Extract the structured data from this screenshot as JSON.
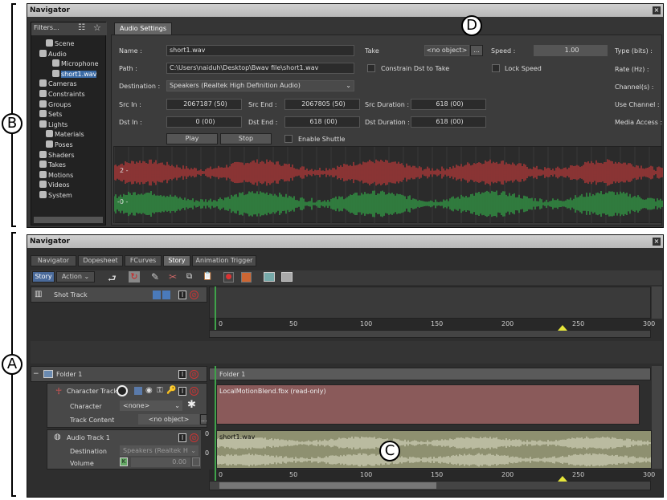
{
  "callouts": {
    "a": "A",
    "b": "B",
    "c": "C",
    "d": "D"
  },
  "top": {
    "title": "Navigator",
    "close": "×",
    "filters": "Filters...",
    "tree": [
      {
        "label": "Scene",
        "color": "#ddd"
      },
      {
        "label": "Audio",
        "color": "#ddd"
      },
      {
        "label": "Microphone",
        "color": "#ddd"
      },
      {
        "label": "short1.wav",
        "color": "#fff"
      },
      {
        "label": "Cameras",
        "color": "#ddd"
      },
      {
        "label": "Constraints",
        "color": "#ddd"
      },
      {
        "label": "Groups",
        "color": "#ddd"
      },
      {
        "label": "Sets",
        "color": "#ddd"
      },
      {
        "label": "Lights",
        "color": "#ddd"
      },
      {
        "label": "Materials",
        "color": "#ddd"
      },
      {
        "label": "Poses",
        "color": "#ddd"
      },
      {
        "label": "Shaders",
        "color": "#ddd"
      },
      {
        "label": "Takes",
        "color": "#ddd"
      },
      {
        "label": "Motions",
        "color": "#ddd"
      },
      {
        "label": "Videos",
        "color": "#ddd"
      },
      {
        "label": "System",
        "color": "#ddd"
      }
    ],
    "tab": "Audio Settings",
    "name_label": "Name :",
    "name_value": "short1.wav",
    "path_label": "Path :",
    "path_value": "C:\\Users\\naiduh\\Desktop\\Bwav file\\short1.wav",
    "dest_label": "Destination :",
    "dest_value": "Speakers (Realtek High Definition Audio)",
    "take_label": "Take",
    "take_value": "<no object>",
    "take_btn": "...",
    "speed_label": "Speed :",
    "speed_value": "1.00",
    "constrain_label": "Constrain Dst to Take",
    "lock_label": "Lock Speed",
    "right_labels": [
      "Type (bits) :",
      "Rate (Hz) :",
      "Channel(s) :",
      "Use Channel :",
      "Media Access :"
    ],
    "src_in_label": "Src In :",
    "src_in_value": "2067187 (50)",
    "src_end_label": "Src End :",
    "src_end_value": "2067805 (50)",
    "src_dur_label": "Src Duration :",
    "src_dur_value": "618 (00)",
    "dst_in_label": "Dst In :",
    "dst_in_value": "0 (00)",
    "dst_end_label": "Dst End :",
    "dst_end_value": "618 (00)",
    "dst_dur_label": "Dst Duration :",
    "dst_dur_value": "618 (00)",
    "play": "Play",
    "stop": "Stop",
    "shuttle_label": "Enable Shuttle",
    "wave_labels": [
      "2 -",
      "-0 -"
    ],
    "colors": {
      "wave_top": "#c83a3a",
      "wave_bottom": "#35b04a"
    }
  },
  "bottom": {
    "title": "Navigator",
    "close": "×",
    "tabs": [
      "Navigator",
      "Dopesheet",
      "FCurves",
      "Story",
      "Animation Trigger"
    ],
    "active_tab": "Story",
    "mode_story": "Story",
    "mode_action": "Action",
    "shot_track": "Shot Track",
    "ruler": [
      "0",
      "50",
      "100",
      "150",
      "200",
      "250",
      "300"
    ],
    "folder": "Folder 1",
    "folder_clip": "Folder 1",
    "char_track": "Character Track",
    "char_label": "Character",
    "char_value": "<none>",
    "content_label": "Track Content",
    "content_value": "<no object>",
    "content_btn": "...",
    "char_clip": "LocalMotionBlend.fbx (read-only)",
    "audio_track": "Audio Track 1",
    "audio_clip": "short1.wav",
    "audio_dest_label": "Destination",
    "audio_dest_value": "Speakers (Realtek H",
    "volume_label": "Volume",
    "volume_value": "0.00",
    "audio_scale": [
      "0",
      "0"
    ],
    "mute_letter": "I",
    "colors": {
      "char_clip": "#8a5a5a",
      "audio_clip": "#8e9070",
      "playhead": "#3fa34a",
      "marker": "#e6e63a"
    }
  }
}
